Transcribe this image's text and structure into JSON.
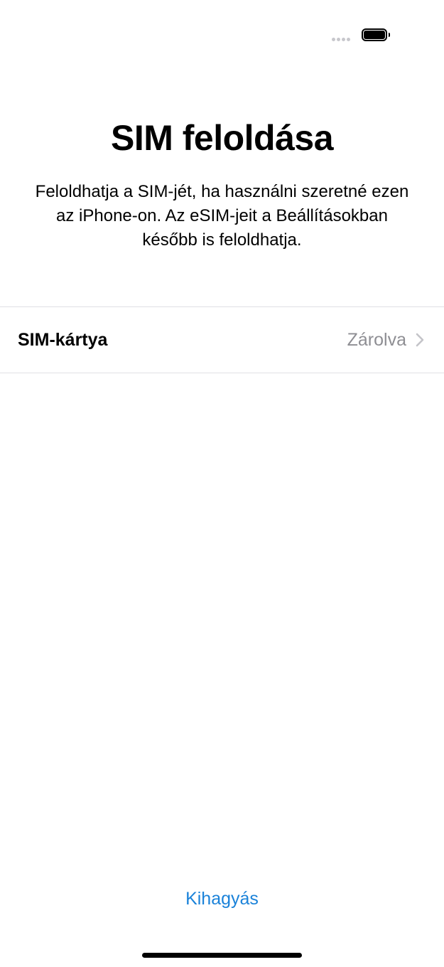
{
  "status_bar": {
    "signal_icon": "signal-dots-icon",
    "battery_icon": "battery-icon"
  },
  "title": "SIM feloldása",
  "description": "Feloldhatja a SIM-jét, ha használni szeretné ezen az iPhone-on. Az eSIM-jeit a Beállításokban később is feloldhatja.",
  "sim_row": {
    "label": "SIM-kártya",
    "status": "Zárolva",
    "chevron_icon": "chevron-right-icon"
  },
  "skip_label": "Kihagyás",
  "colors": {
    "accent": "#1a82d9",
    "secondary_text": "#8e8e93",
    "divider": "#e0e0e5"
  }
}
